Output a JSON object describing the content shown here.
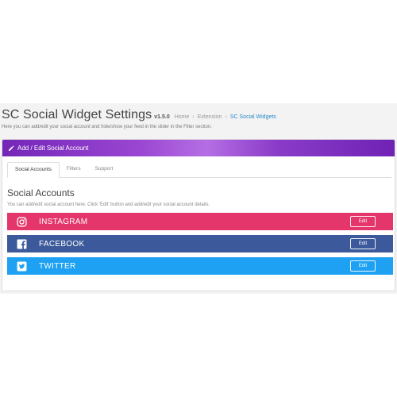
{
  "header": {
    "title": "SC Social Widget Settings",
    "version": "v1.5.0",
    "breadcrumbs": [
      "Home",
      "Extension",
      "SC Social Widgets"
    ],
    "separator": "›",
    "subtitle": "Here you can add/edit your social account and hide/show your feed in the slider in the Filter section."
  },
  "panel": {
    "heading": "Add / Edit Social Account",
    "tabs": [
      "Social Accounts",
      "Filters",
      "Support"
    ],
    "active_tab": "Social Accounts",
    "section_title": "Social Accounts",
    "section_desc": "You can add/edit social account here. Click 'Edit' button and add/edit your social account details.",
    "accounts": [
      {
        "name": "INSTAGRAM",
        "icon": "instagram-icon",
        "color": "#e4366b",
        "edit_label": "Edit"
      },
      {
        "name": "FACEBOOK",
        "icon": "facebook-icon",
        "color": "#3c5a9b",
        "edit_label": "Edit"
      },
      {
        "name": "TWITTER",
        "icon": "twitter-icon",
        "color": "#1ea1f2",
        "edit_label": "Edit"
      }
    ]
  },
  "colors": {
    "heading_gradient_start": "#7426b8",
    "heading_gradient_mid": "#b56ee4",
    "breadcrumb_active": "#2b88c8"
  }
}
